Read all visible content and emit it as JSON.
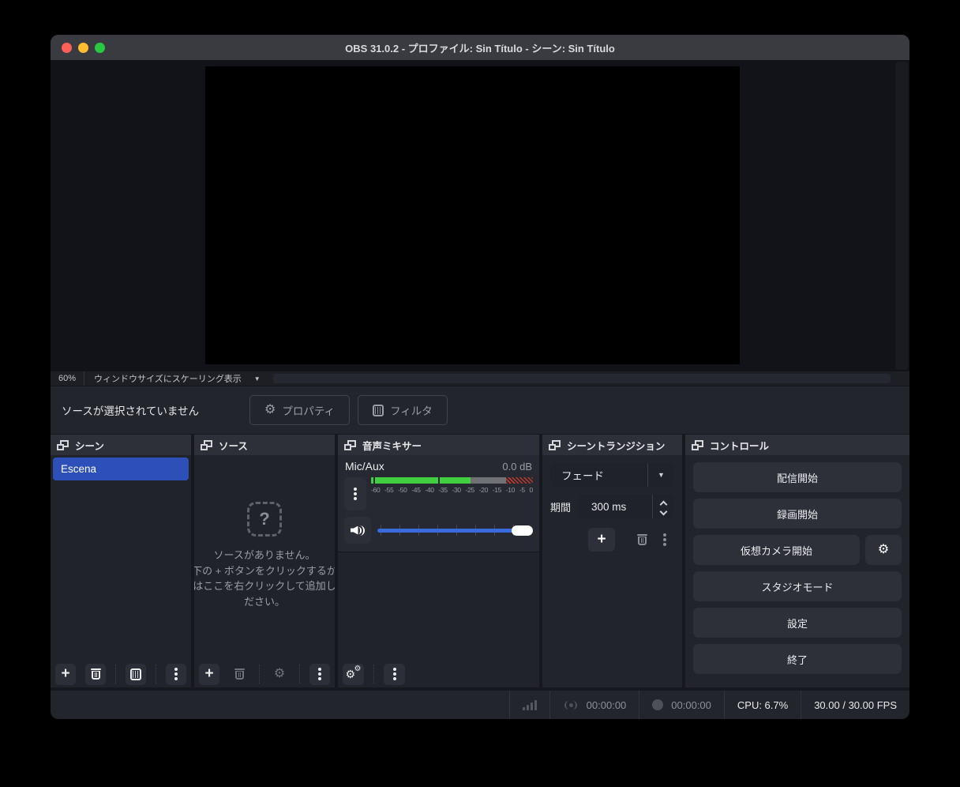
{
  "titlebar": {
    "title": "OBS 31.0.2 - プロファイル: Sin Título - シーン: Sin Título"
  },
  "preview_bar": {
    "zoom": "60%",
    "scale_label": "ウィンドウサイズにスケーリング表示",
    "caret": "▼"
  },
  "context_bar": {
    "message": "ソースが選択されていません",
    "properties_label": "プロパティ",
    "filters_label": "フィルタ",
    "gear_glyph": "⚙"
  },
  "scenes": {
    "title": "シーン",
    "items": [
      {
        "label": "Escena"
      }
    ]
  },
  "sources": {
    "title": "ソース",
    "empty_icon": "?",
    "empty_line1": "ソースがありません。",
    "empty_line2": "下の + ボタンをクリックするか",
    "empty_line3": "はここを右クリックして追加し",
    "empty_line4": "ださい。"
  },
  "mixer": {
    "title": "音声ミキサー",
    "channel_name": "Mic/Aux",
    "level_db": "0.0 dB",
    "ticks": [
      "-60",
      "-55",
      "-50",
      "-45",
      "-40",
      "-35",
      "-30",
      "-25",
      "-20",
      "-15",
      "-10",
      "-5",
      "0"
    ],
    "gear_glyph": "⚙"
  },
  "transitions": {
    "title": "シーントランジション",
    "selected": "フェード",
    "caret": "▼",
    "duration_label": "期間",
    "duration_value": "300 ms",
    "plus_glyph": "+"
  },
  "controls": {
    "title": "コントロール",
    "stream": "配信開始",
    "record": "録画開始",
    "virtual_camera": "仮想カメラ開始",
    "studio_mode": "スタジオモード",
    "settings": "設定",
    "exit": "終了",
    "gear_glyph": "⚙"
  },
  "statusbar": {
    "stream_time": "00:00:00",
    "record_time": "00:00:00",
    "cpu": "CPU: 6.7%",
    "fps": "30.00 / 30.00 FPS"
  },
  "toolbar_glyphs": {
    "plus": "+"
  },
  "colors": {
    "accent_blue": "#2c4fb8",
    "slider_blue": "#3a6bdd",
    "meter_green": "#41cf41",
    "meter_gray": "#707175",
    "meter_red": "#c0392b"
  }
}
